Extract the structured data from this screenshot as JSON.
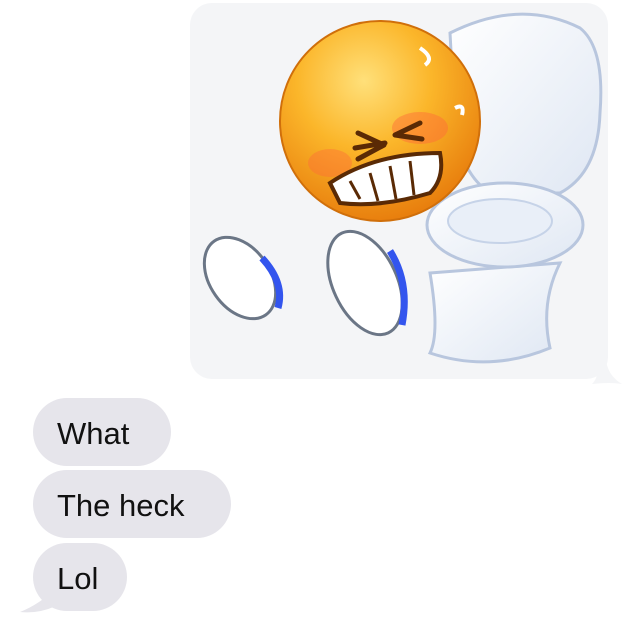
{
  "thread": {
    "image_message": {
      "alt": "emoji sitting on toilet",
      "icon": "emoji-on-toilet-image"
    },
    "messages": [
      {
        "text": "What"
      },
      {
        "text": "The heck"
      },
      {
        "text": "Lol"
      }
    ]
  },
  "colors": {
    "received_bubble": "#e6e5eb",
    "image_bubble_bg": "#f4f5f7",
    "emoji_face": "#f6a313",
    "toilet": "#f8fafd"
  }
}
